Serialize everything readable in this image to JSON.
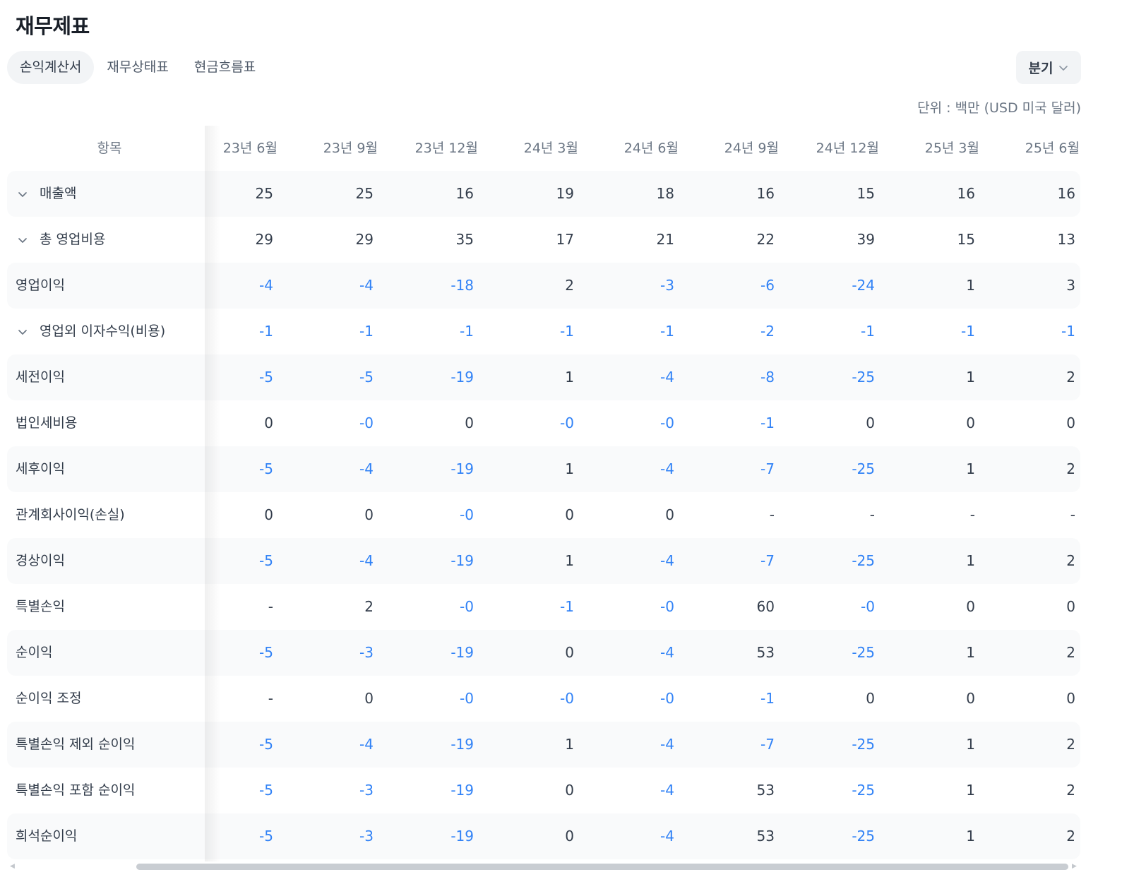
{
  "title": "재무제표",
  "tabs": [
    {
      "label": "손익계산서",
      "active": true
    },
    {
      "label": "재무상태표",
      "active": false
    },
    {
      "label": "현금흐름표",
      "active": false
    }
  ],
  "period_select": {
    "label": "분기",
    "icon": "chevron-down-icon"
  },
  "unit_text": "단위 : 백만 (USD 미국 달러)",
  "table": {
    "item_header": "항목",
    "columns": [
      "23년 6월",
      "23년 9월",
      "23년 12월",
      "24년 3월",
      "24년 6월",
      "24년 9월",
      "24년 12월",
      "25년 3월",
      "25년 6월"
    ],
    "rows": [
      {
        "label": "매출액",
        "expandable": true,
        "values": [
          "25",
          "25",
          "16",
          "19",
          "18",
          "16",
          "15",
          "16",
          "16"
        ]
      },
      {
        "label": "총 영업비용",
        "expandable": true,
        "values": [
          "29",
          "29",
          "35",
          "17",
          "21",
          "22",
          "39",
          "15",
          "13"
        ]
      },
      {
        "label": "영업이익",
        "expandable": false,
        "values": [
          "-4",
          "-4",
          "-18",
          "2",
          "-3",
          "-6",
          "-24",
          "1",
          "3"
        ]
      },
      {
        "label": "영업외 이자수익(비용)",
        "expandable": true,
        "values": [
          "-1",
          "-1",
          "-1",
          "-1",
          "-1",
          "-2",
          "-1",
          "-1",
          "-1"
        ]
      },
      {
        "label": "세전이익",
        "expandable": false,
        "values": [
          "-5",
          "-5",
          "-19",
          "1",
          "-4",
          "-8",
          "-25",
          "1",
          "2"
        ]
      },
      {
        "label": "법인세비용",
        "expandable": false,
        "values": [
          "0",
          "-0",
          "0",
          "-0",
          "-0",
          "-1",
          "0",
          "0",
          "0"
        ]
      },
      {
        "label": "세후이익",
        "expandable": false,
        "values": [
          "-5",
          "-4",
          "-19",
          "1",
          "-4",
          "-7",
          "-25",
          "1",
          "2"
        ]
      },
      {
        "label": "관계회사이익(손실)",
        "expandable": false,
        "values": [
          "0",
          "0",
          "-0",
          "0",
          "0",
          "-",
          "-",
          "-",
          "-"
        ]
      },
      {
        "label": "경상이익",
        "expandable": false,
        "values": [
          "-5",
          "-4",
          "-19",
          "1",
          "-4",
          "-7",
          "-25",
          "1",
          "2"
        ]
      },
      {
        "label": "특별손익",
        "expandable": false,
        "values": [
          "-",
          "2",
          "-0",
          "-1",
          "-0",
          "60",
          "-0",
          "0",
          "0"
        ]
      },
      {
        "label": "순이익",
        "expandable": false,
        "values": [
          "-5",
          "-3",
          "-19",
          "0",
          "-4",
          "53",
          "-25",
          "1",
          "2"
        ]
      },
      {
        "label": "순이익 조정",
        "expandable": false,
        "values": [
          "-",
          "0",
          "-0",
          "-0",
          "-0",
          "-1",
          "0",
          "0",
          "0"
        ]
      },
      {
        "label": "특별손익 제외 순이익",
        "expandable": false,
        "values": [
          "-5",
          "-4",
          "-19",
          "1",
          "-4",
          "-7",
          "-25",
          "1",
          "2"
        ]
      },
      {
        "label": "특별손익 포함 순이익",
        "expandable": false,
        "values": [
          "-5",
          "-3",
          "-19",
          "0",
          "-4",
          "53",
          "-25",
          "1",
          "2"
        ]
      },
      {
        "label": "희석순이익",
        "expandable": false,
        "values": [
          "-5",
          "-3",
          "-19",
          "0",
          "-4",
          "53",
          "-25",
          "1",
          "2"
        ]
      }
    ]
  },
  "colors": {
    "negative": "#3182f6",
    "positive": "#333d4b",
    "row_shade": "#f9fafb"
  }
}
